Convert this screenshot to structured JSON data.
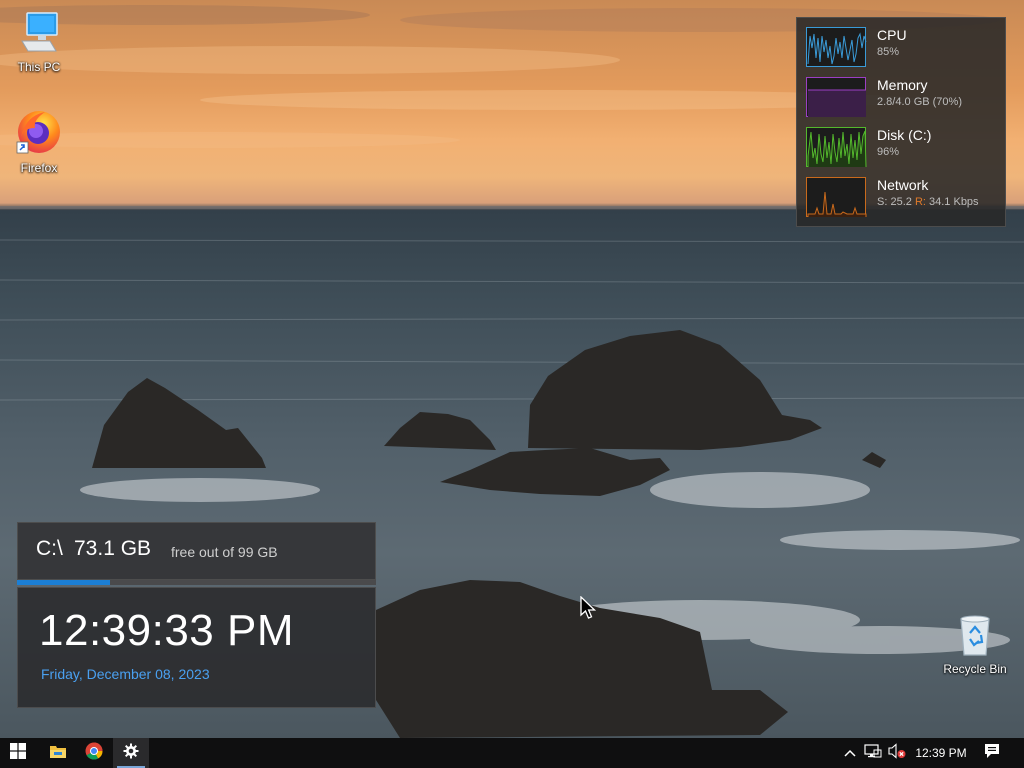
{
  "desktop": {
    "icons": [
      {
        "label": "This PC",
        "icon": "computer-icon"
      },
      {
        "label": "Firefox",
        "icon": "firefox-icon"
      },
      {
        "label": "Recycle Bin",
        "icon": "recycle-bin-icon"
      }
    ]
  },
  "performance_widget": {
    "rows": [
      {
        "name": "CPU",
        "value": "85%",
        "color": "#3a9bd8"
      },
      {
        "name": "Memory",
        "value": "2.8/4.0 GB (70%)",
        "color": "#9b3fc4"
      },
      {
        "name": "Disk (C:)",
        "value": "96%",
        "color": "#54b82d"
      },
      {
        "name": "Network",
        "send_label": "S:",
        "send_value": "25.2",
        "recv_label": "R:",
        "recv_value": "34.1 Kbps",
        "color": "#c96a1c"
      }
    ]
  },
  "disk_widget": {
    "drive": "C:\\",
    "free": "73.1 GB",
    "caption": "free out of 99 GB",
    "used_fraction": 0.26,
    "accent": "#1b7fd6"
  },
  "clock_widget": {
    "time": "12:39:33 PM",
    "date": "Friday, December 08, 2023",
    "date_color": "#4aa0f0"
  },
  "taskbar": {
    "start_icon": "windows-start-icon",
    "pinned": [
      {
        "icon": "file-explorer-icon",
        "active": false
      },
      {
        "icon": "chrome-icon",
        "active": false
      },
      {
        "icon": "settings-icon",
        "active": true
      }
    ],
    "tray": {
      "chevron": "show-hidden-icons-chevron",
      "network": "network-icon",
      "volume": "volume-muted-icon",
      "time": "12:39 PM",
      "notifications": "action-center-icon"
    }
  }
}
